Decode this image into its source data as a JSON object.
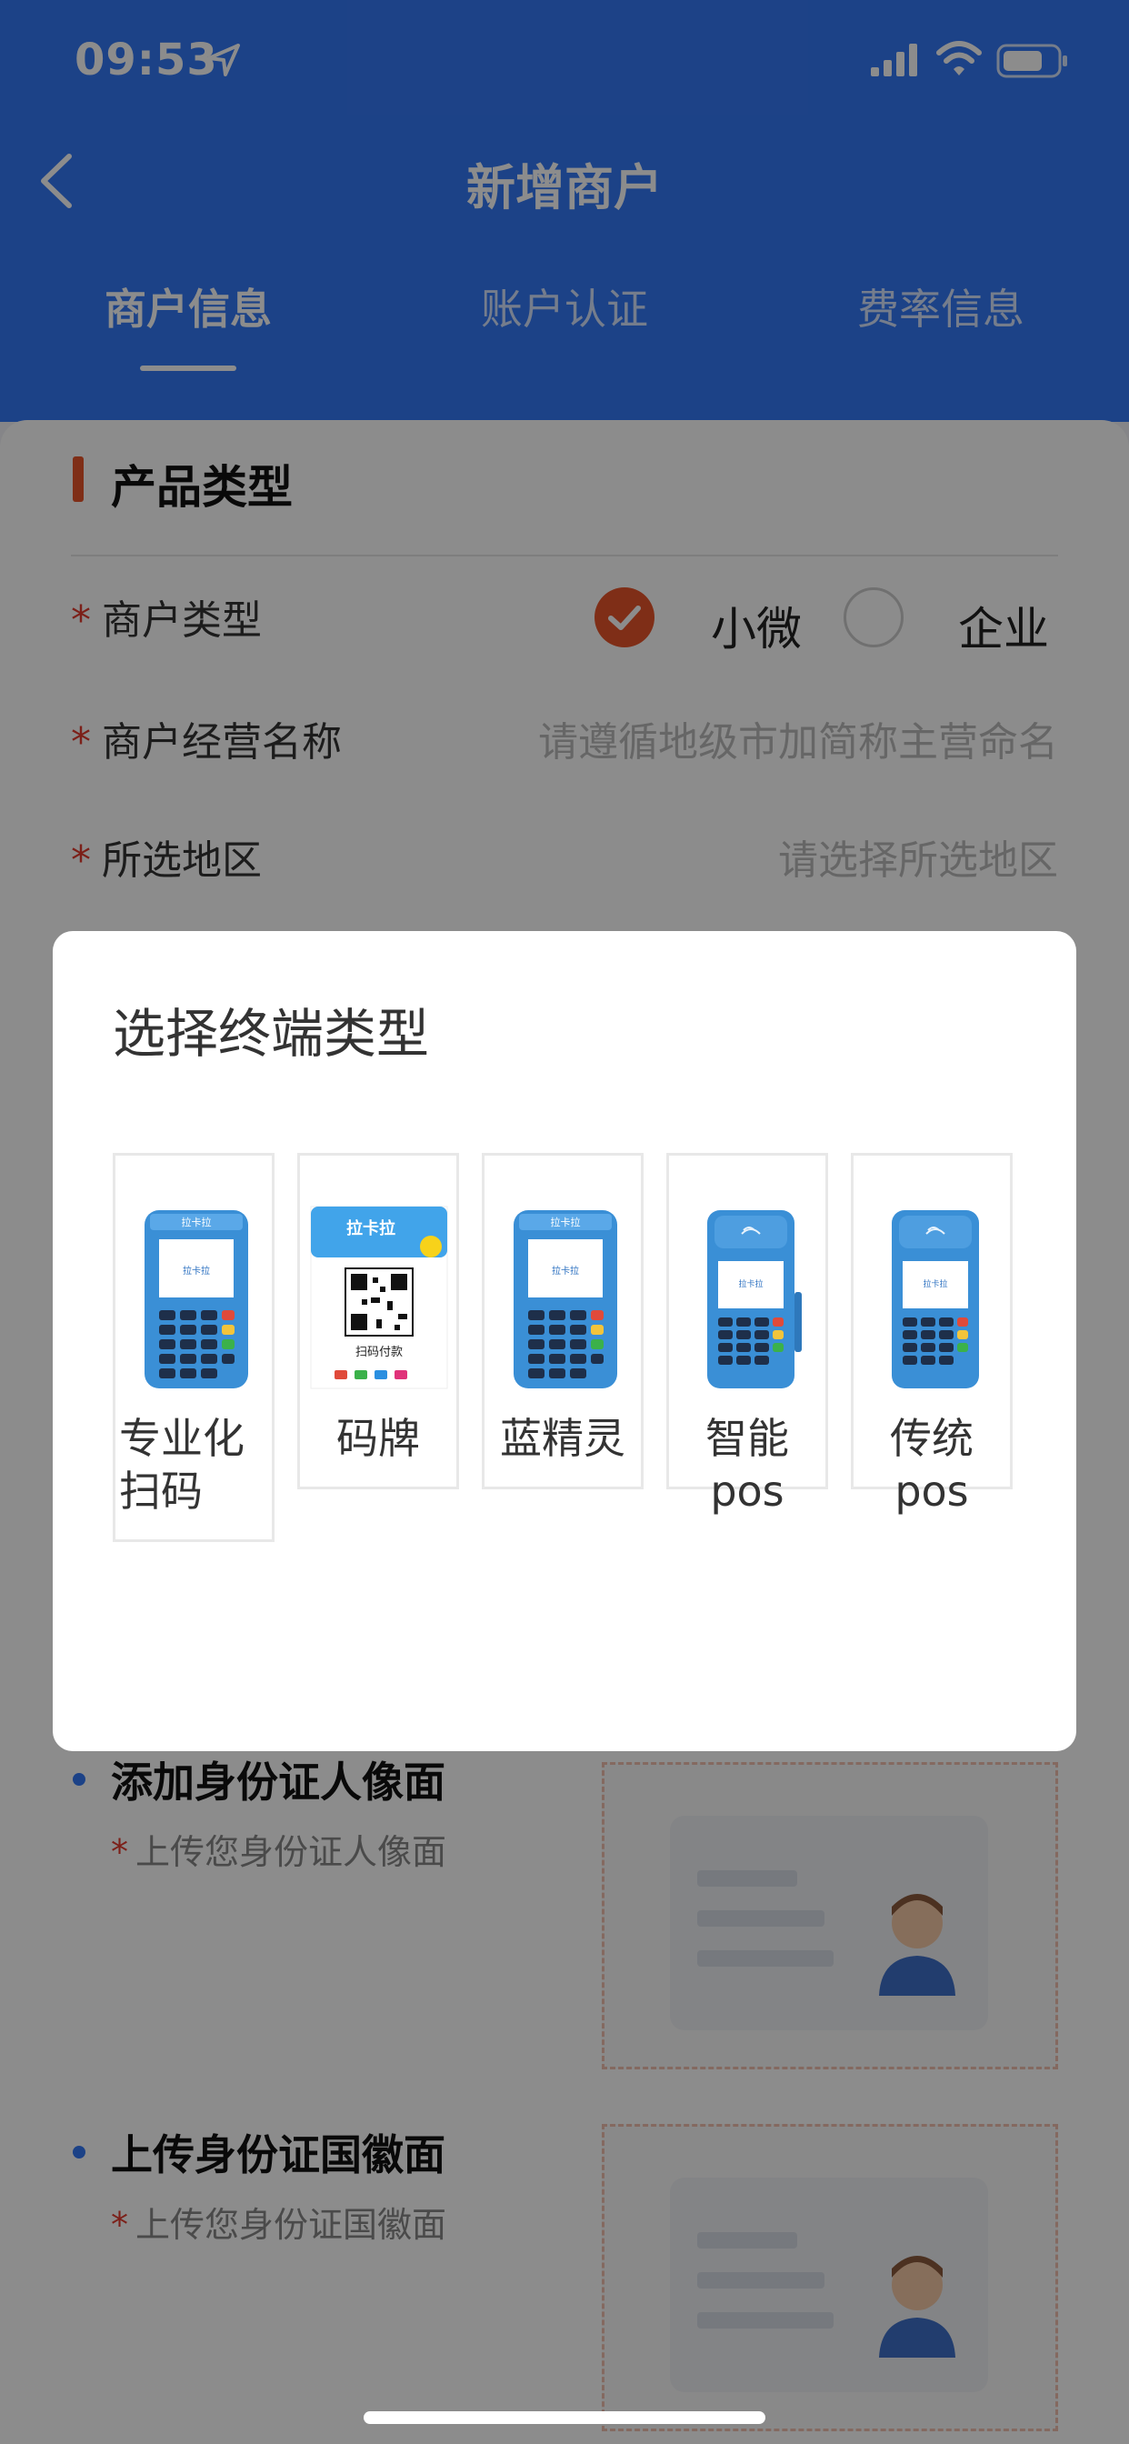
{
  "status_bar": {
    "time": "09:53"
  },
  "nav": {
    "title": "新增商户"
  },
  "tabs": [
    {
      "label": "商户信息"
    },
    {
      "label": "账户认证"
    },
    {
      "label": "费率信息"
    }
  ],
  "section": {
    "title": "产品类型"
  },
  "form": {
    "merchant_type": {
      "label": "商户类型",
      "option1": "小微",
      "option2": "企业",
      "selected": "小微"
    },
    "business_name": {
      "label": "商户经营名称",
      "placeholder": "请遵循地级市加简称主营命名"
    },
    "region": {
      "label": "所选地区",
      "placeholder": "请选择所选地区"
    },
    "required_mark": "*"
  },
  "uploads": [
    {
      "title": "添加身份证人像面",
      "sub": "上传您身份证人像面"
    },
    {
      "title": "上传身份证国徽面",
      "sub": "上传您身份证国徽面"
    }
  ],
  "modal": {
    "title": "选择终端类型",
    "terminals": [
      {
        "name": "专业化扫码",
        "line1": "专业化",
        "line2": "扫码",
        "image": "pos-keypad-terminal"
      },
      {
        "name": "码牌",
        "image": "qr-code-plate"
      },
      {
        "name": "蓝精灵",
        "image": "pos-keypad-terminal"
      },
      {
        "name": "智能pos",
        "image": "smart-pos-terminal"
      },
      {
        "name": "传统pos",
        "image": "traditional-pos-terminal"
      }
    ]
  },
  "qr_plate": {
    "brand": "拉卡拉",
    "caption": "扫码付款"
  },
  "pos_brand": "拉卡拉",
  "colors": {
    "primary": "#3478f6",
    "accent": "#e8552a",
    "required": "#e23b2e"
  }
}
